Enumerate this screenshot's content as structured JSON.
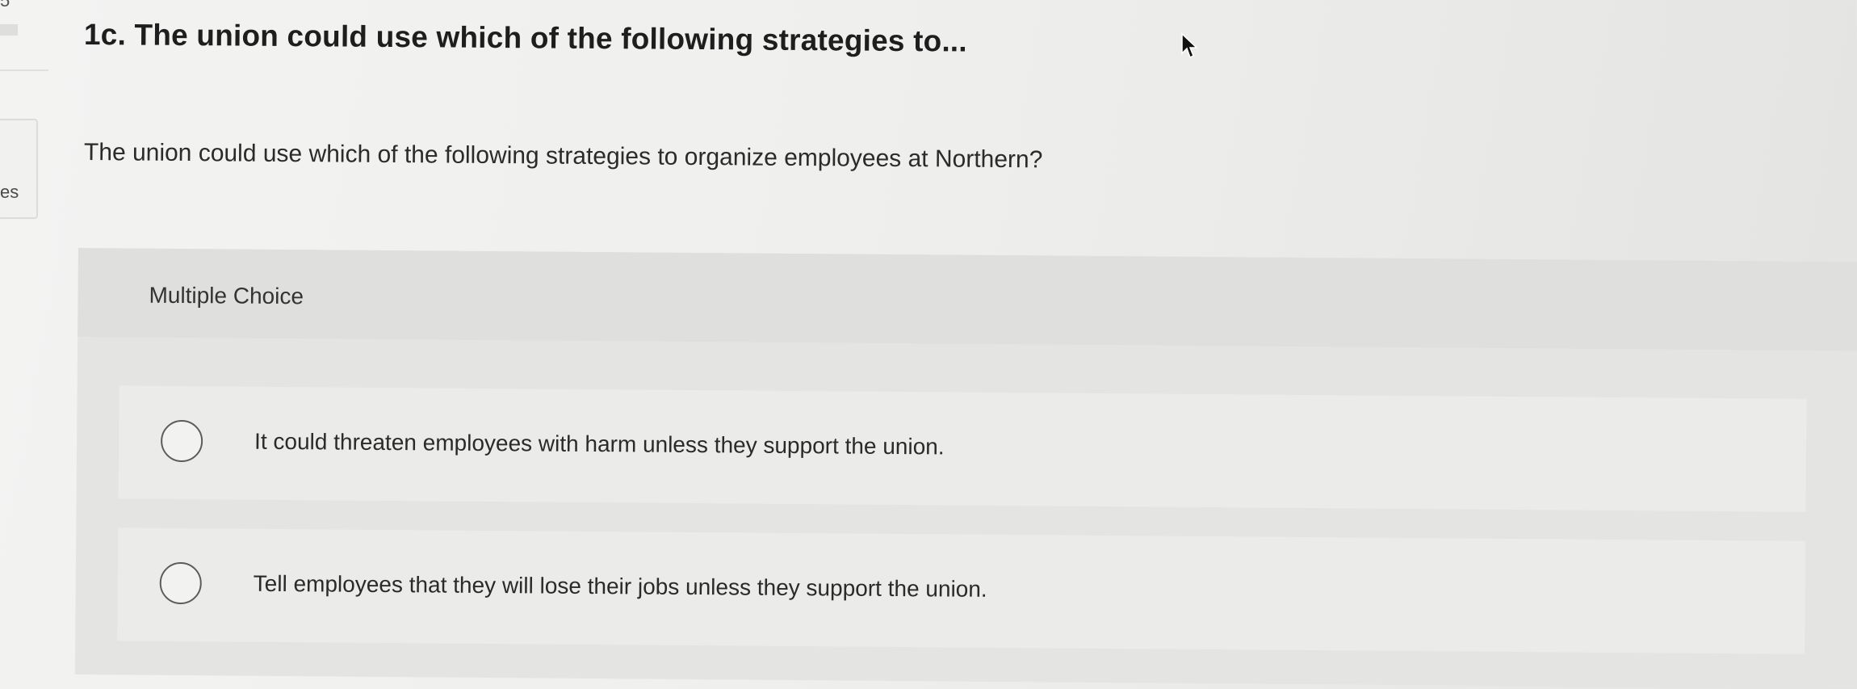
{
  "sidebar": {
    "top_number": "5",
    "partial_label": "es"
  },
  "question": {
    "title": "1c. The union could use which of the following strategies to...",
    "text": "The union could use which of the following strategies to organize employees at Northern?"
  },
  "multiple_choice": {
    "label": "Multiple Choice",
    "options": [
      {
        "text": "It could threaten employees with harm unless they support the union.",
        "selected": false
      },
      {
        "text": "Tell employees that they will lose their jobs unless they support the union.",
        "selected": false
      }
    ]
  },
  "icons": {
    "cursor": "mouse-pointer-icon",
    "radio": "radio-circle-icon"
  }
}
